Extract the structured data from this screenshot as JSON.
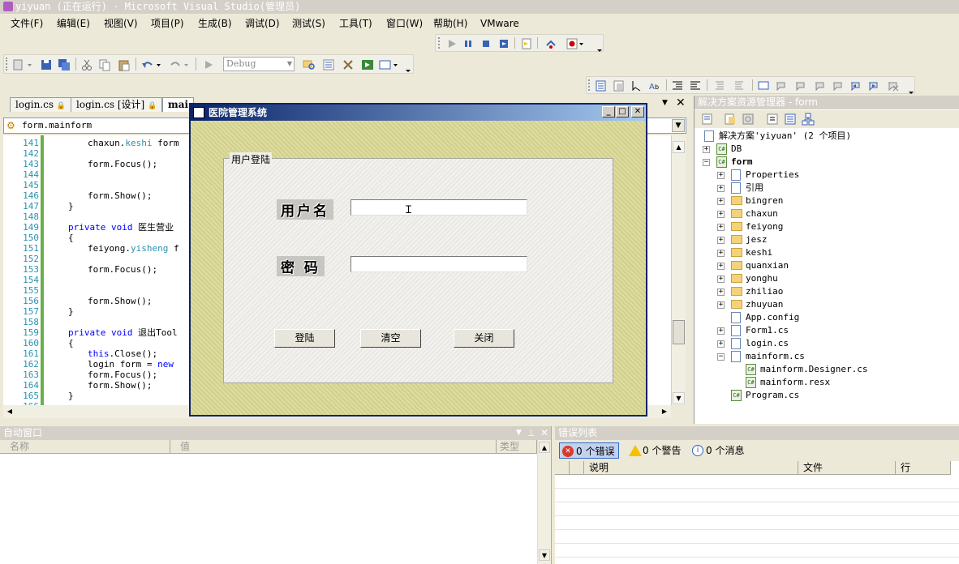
{
  "window": {
    "title": "yiyuan (正在运行) - Microsoft Visual Studio(管理员)"
  },
  "menu": [
    "文件(F)",
    "编辑(E)",
    "视图(V)",
    "项目(P)",
    "生成(B)",
    "调试(D)",
    "测试(S)",
    "工具(T)",
    "窗口(W)",
    "帮助(H)",
    "VMware"
  ],
  "toolbar": {
    "config_combo": "Debug"
  },
  "editor": {
    "tabs": [
      "login.cs",
      "login.cs [设计]",
      "mai"
    ],
    "nav_combo": "form.mainform",
    "lines": [
      {
        "n": "141",
        "t": "chaxun.keshi form",
        "ind": 3
      },
      {
        "n": "142",
        "t": "",
        "ind": 3
      },
      {
        "n": "143",
        "t": "form.Focus();",
        "ind": 3
      },
      {
        "n": "144",
        "t": "",
        "ind": 3
      },
      {
        "n": "145",
        "t": "",
        "ind": 3
      },
      {
        "n": "146",
        "t": "form.Show();",
        "ind": 3
      },
      {
        "n": "147",
        "t": "}",
        "ind": 2
      },
      {
        "n": "148",
        "t": "",
        "ind": 2
      },
      {
        "n": "149",
        "t": "private void 医生营业",
        "ind": 2
      },
      {
        "n": "150",
        "t": "{",
        "ind": 2
      },
      {
        "n": "151",
        "t": "feiyong.yisheng f",
        "ind": 3
      },
      {
        "n": "152",
        "t": "",
        "ind": 3
      },
      {
        "n": "153",
        "t": "form.Focus();",
        "ind": 3
      },
      {
        "n": "154",
        "t": "",
        "ind": 3
      },
      {
        "n": "155",
        "t": "",
        "ind": 3
      },
      {
        "n": "156",
        "t": "form.Show();",
        "ind": 3
      },
      {
        "n": "157",
        "t": "}",
        "ind": 2
      },
      {
        "n": "158",
        "t": "",
        "ind": 2
      },
      {
        "n": "159",
        "t": "private void 退出Tool",
        "ind": 2
      },
      {
        "n": "160",
        "t": "{",
        "ind": 2
      },
      {
        "n": "161",
        "t": "this.Close();",
        "ind": 3
      },
      {
        "n": "162",
        "t": "login form = new",
        "ind": 3
      },
      {
        "n": "163",
        "t": "form.Focus();",
        "ind": 3
      },
      {
        "n": "164",
        "t": "form.Show();",
        "ind": 3
      },
      {
        "n": "165",
        "t": "}",
        "ind": 2
      },
      {
        "n": "166",
        "t": "",
        "ind": 2
      }
    ]
  },
  "dialog": {
    "title": "医院管理系统",
    "group_label": "用户登陆",
    "username_label": "用户名",
    "password_label": "密  码",
    "username_value": "",
    "password_value": "",
    "login_button": "登陆",
    "clear_button": "清空",
    "close_button": "关闭"
  },
  "solution_explorer": {
    "title": "解决方案资源管理器 - form",
    "items": [
      {
        "label": "解决方案'yiyuan' (2 个项目)",
        "level": 0,
        "icon": "solution-icon",
        "exp": ""
      },
      {
        "label": "DB",
        "level": 1,
        "icon": "project-icon",
        "exp": "+"
      },
      {
        "label": "form",
        "level": 1,
        "icon": "project-icon",
        "exp": "-",
        "bold": true
      },
      {
        "label": "Properties",
        "level": 2,
        "icon": "properties-icon",
        "exp": "+"
      },
      {
        "label": "引用",
        "level": 2,
        "icon": "references-icon",
        "exp": "+"
      },
      {
        "label": "bingren",
        "level": 2,
        "icon": "folder-icon",
        "exp": "+"
      },
      {
        "label": "chaxun",
        "level": 2,
        "icon": "folder-icon",
        "exp": "+"
      },
      {
        "label": "feiyong",
        "level": 2,
        "icon": "folder-icon",
        "exp": "+"
      },
      {
        "label": "jesz",
        "level": 2,
        "icon": "folder-icon",
        "exp": "+"
      },
      {
        "label": "keshi",
        "level": 2,
        "icon": "folder-icon",
        "exp": "+"
      },
      {
        "label": "quanxian",
        "level": 2,
        "icon": "folder-icon",
        "exp": "+"
      },
      {
        "label": "yonghu",
        "level": 2,
        "icon": "folder-icon",
        "exp": "+"
      },
      {
        "label": "zhiliao",
        "level": 2,
        "icon": "folder-icon",
        "exp": "+"
      },
      {
        "label": "zhuyuan",
        "level": 2,
        "icon": "folder-icon",
        "exp": "+"
      },
      {
        "label": "App.config",
        "level": 2,
        "icon": "config-file-icon",
        "exp": ""
      },
      {
        "label": "Form1.cs",
        "level": 2,
        "icon": "form-file-icon",
        "exp": "+"
      },
      {
        "label": "login.cs",
        "level": 2,
        "icon": "form-file-icon",
        "exp": "+"
      },
      {
        "label": "mainform.cs",
        "level": 2,
        "icon": "form-file-icon",
        "exp": "-"
      },
      {
        "label": "mainform.Designer.cs",
        "level": 3,
        "icon": "cs-file-icon",
        "exp": ""
      },
      {
        "label": "mainform.resx",
        "level": 3,
        "icon": "resx-file-icon",
        "exp": ""
      },
      {
        "label": "Program.cs",
        "level": 2,
        "icon": "cs-file-icon",
        "exp": ""
      }
    ]
  },
  "autos_panel": {
    "title": "自动窗口",
    "columns": [
      "名称",
      "值",
      "类型"
    ]
  },
  "error_list": {
    "title": "错误列表",
    "errors": "0 个错误",
    "warnings": "0 个警告",
    "messages": "0 个消息",
    "columns": [
      "说明",
      "文件",
      "行"
    ]
  }
}
